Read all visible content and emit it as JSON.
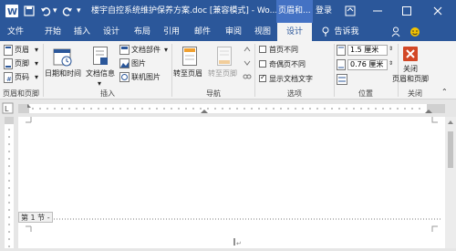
{
  "title_bar": {
    "doc_title": "楼宇自控系统维护保养方案.doc [兼容模式] - Wo...",
    "context_tab_header": "页眉和...",
    "login": "登录"
  },
  "tabs": [
    {
      "label": "文件"
    },
    {
      "label": "开始"
    },
    {
      "label": "插入"
    },
    {
      "label": "设计"
    },
    {
      "label": "布局"
    },
    {
      "label": "引用"
    },
    {
      "label": "邮件"
    },
    {
      "label": "审阅"
    },
    {
      "label": "视图"
    },
    {
      "label": "设计"
    }
  ],
  "tell_me": "告诉我",
  "ribbon": {
    "header_btn": "页眉",
    "footer_btn": "页脚",
    "page_number_btn": "页码",
    "datetime_btn": "日期和时间",
    "docinfo_btn": "文档信息",
    "docparts_btn": "文档部件",
    "picture_btn": "图片",
    "online_picture_btn": "联机图片",
    "goto_header_btn": "转至页眉",
    "goto_footer_btn": "转至页脚",
    "opt_first_page": "首页不同",
    "opt_odd_even": "奇偶页不同",
    "opt_show_text": "显示文档文字",
    "opt_first_page_checked": false,
    "opt_odd_even_checked": false,
    "opt_show_text_checked": true,
    "header_pos_value": "1.5 厘米",
    "footer_pos_value": "0.76 厘米",
    "close_btn_line1": "关闭",
    "close_btn_line2": "页眉和页脚"
  },
  "groups": {
    "header_footer": "页眉和页脚",
    "insert": "插入",
    "navigation": "导航",
    "options": "选项",
    "position": "位置",
    "close": "关闭"
  },
  "document": {
    "section_label": "第 1 节 -"
  },
  "colors": {
    "accent": "#2b579a",
    "close_red": "#d24726"
  }
}
